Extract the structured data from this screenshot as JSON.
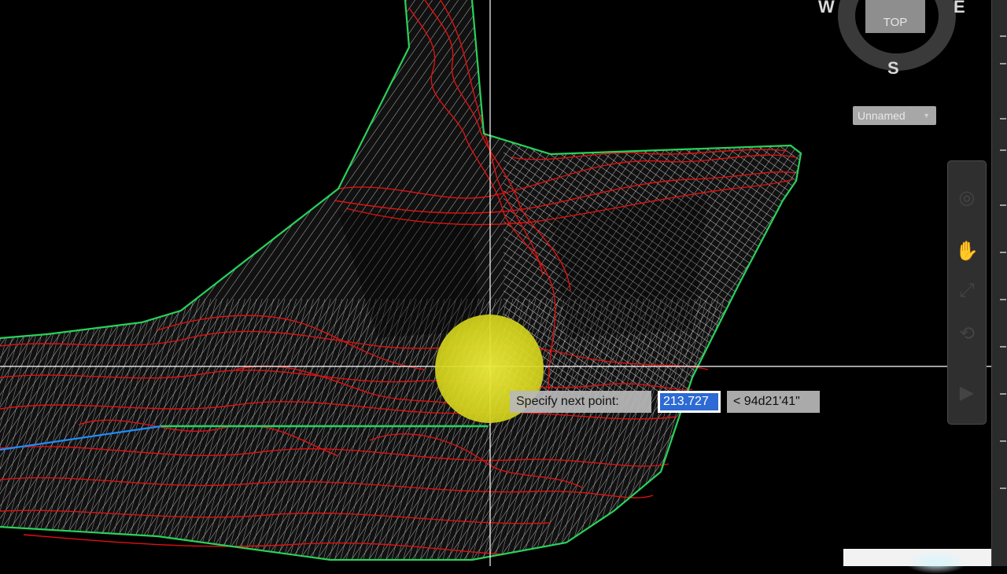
{
  "viewcube": {
    "top_label": "TOP",
    "west": "W",
    "east": "E",
    "south": "S"
  },
  "ucs": {
    "label": "Unnamed"
  },
  "dynamic_input": {
    "prompt": "Specify next point:",
    "distance": "213.727",
    "angle": "< 94d21'41\""
  },
  "navbar": {
    "tools": [
      "steering-wheel-icon",
      "pan-hand-icon",
      "zoom-extents-icon",
      "orbit-icon",
      "showmotion-icon"
    ]
  },
  "colors": {
    "background": "#000000",
    "boundary": "#28d25a",
    "contour_major": "#e01010",
    "contour_minor": "#d8d8d8",
    "crosshair": "#ffffff",
    "feature_line": "#1e8cff",
    "highlight": "#e8e83a",
    "selection": "#2d6ad3"
  }
}
